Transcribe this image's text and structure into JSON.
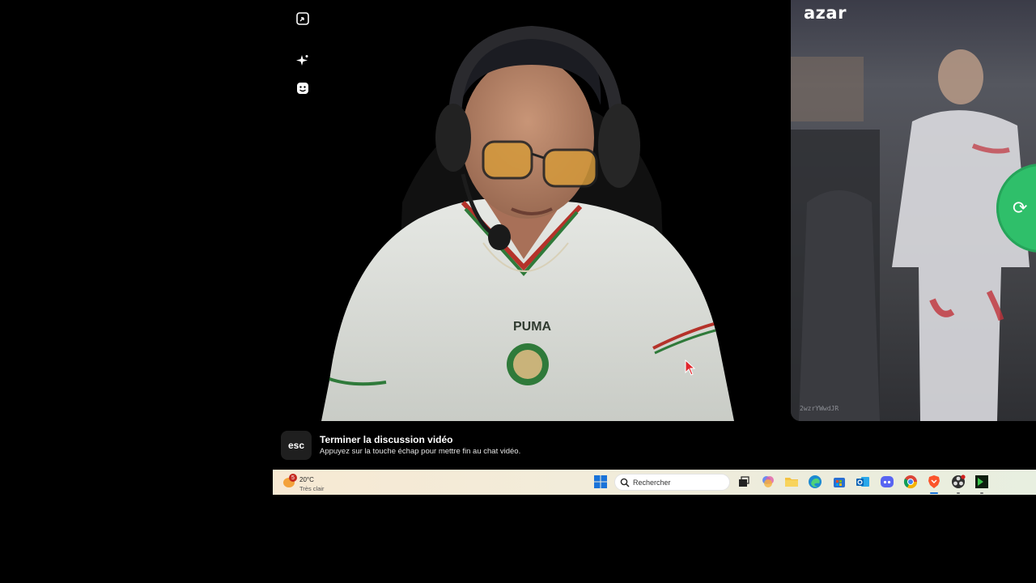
{
  "app": {
    "brand": "azar",
    "partner_id": "2wzrYWwdJR"
  },
  "local_tools": {
    "icons": [
      "shrink-window-icon",
      "sparkle-effects-icon",
      "face-filter-icon"
    ]
  },
  "esc_hint": {
    "key_label": "esc",
    "title": "Terminer la discussion vidéo",
    "description": "Appuyez sur la touche échap pour mettre fin au chat vidéo."
  },
  "taskbar": {
    "weather": {
      "badge_count": "5",
      "temperature": "20°C",
      "condition": "Très clair"
    },
    "search_placeholder": "Rechercher",
    "apps": [
      "start-icon",
      "task-view-icon",
      "copilot-icon",
      "file-explorer-icon",
      "edge-icon",
      "store-icon",
      "outlook-icon",
      "discord-icon",
      "chrome-icon",
      "brave-icon",
      "obs-icon",
      "terminal-icon"
    ]
  },
  "colors": {
    "next_button": "#2fbf6a",
    "taskbar_start": "#1a73d9"
  }
}
